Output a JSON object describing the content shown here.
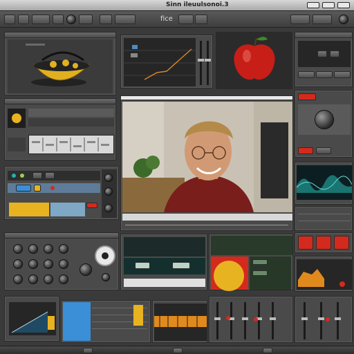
{
  "app": {
    "title": "Sinn ileuulsonoi.3",
    "center_label": "fice"
  },
  "toolbar": {
    "buttons": [
      "",
      "",
      "",
      "",
      "",
      "",
      "",
      ""
    ],
    "window_controls": [
      "",
      "",
      ""
    ]
  },
  "video": {
    "status_bar_text": ""
  },
  "colors": {
    "accent_red": "#d42a1e",
    "accent_yellow": "#e8b321",
    "accent_blue": "#3a8fd6",
    "accent_teal": "#2bb0a8",
    "panel_bg": "#4a4a4a",
    "window_bg": "#3a3a3a"
  },
  "icons": {
    "yellow_bowl": "yellow-bowl-thumbnail-icon",
    "apple": "red-apple-thumbnail-icon",
    "person": "person-video-thumbnail-icon",
    "ring": "ring-knob-icon",
    "sun": "yellow-sun-icon"
  }
}
